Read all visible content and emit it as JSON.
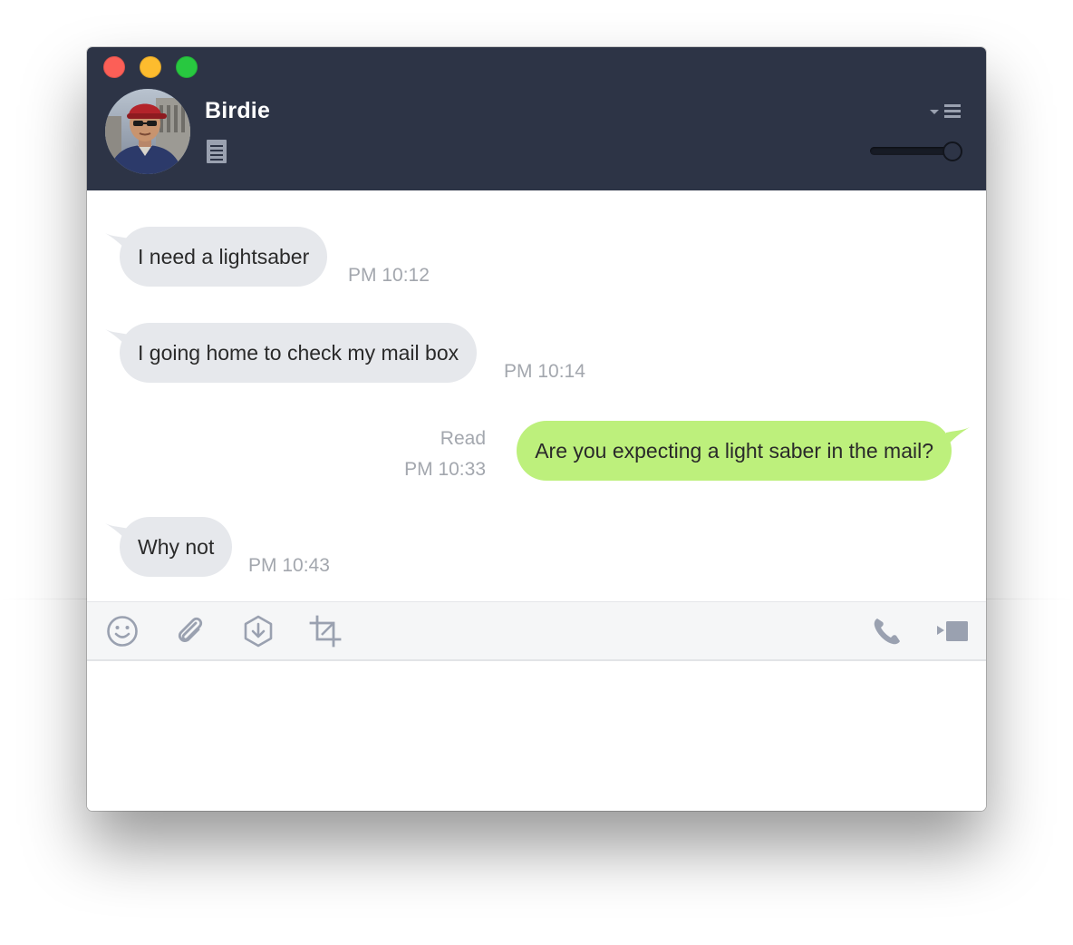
{
  "window": {
    "controls": {
      "close_color": "#fc5f57",
      "minimize_color": "#fdbc2e",
      "maximize_color": "#28c840"
    }
  },
  "header": {
    "contact_name": "Birdie",
    "background_color": "#2d3446",
    "icons": {
      "memo": "memo-icon",
      "menu": "dropdown-menu-icon"
    }
  },
  "messages": [
    {
      "direction": "incoming",
      "text": "I need a lightsaber",
      "time": "PM 10:12"
    },
    {
      "direction": "incoming",
      "text": "I going home to check my mail box",
      "time": "PM 10:14"
    },
    {
      "direction": "outgoing",
      "text": "Are you expecting a light saber in the mail?",
      "status": "Read",
      "time": "PM 10:33"
    },
    {
      "direction": "incoming",
      "text": "Why not",
      "time": "PM 10:43"
    }
  ],
  "colors": {
    "incoming_bubble": "#e6e8ec",
    "outgoing_bubble": "#bdf07c",
    "timestamp": "#a3a7ae",
    "toolbar_icon": "#9aa1b0"
  },
  "toolbar": {
    "left_icons": [
      "emoji-icon",
      "attach-icon",
      "download-icon",
      "crop-icon"
    ],
    "right_icons": [
      "phone-icon",
      "video-call-icon"
    ]
  },
  "composer": {
    "value": "",
    "placeholder": ""
  }
}
